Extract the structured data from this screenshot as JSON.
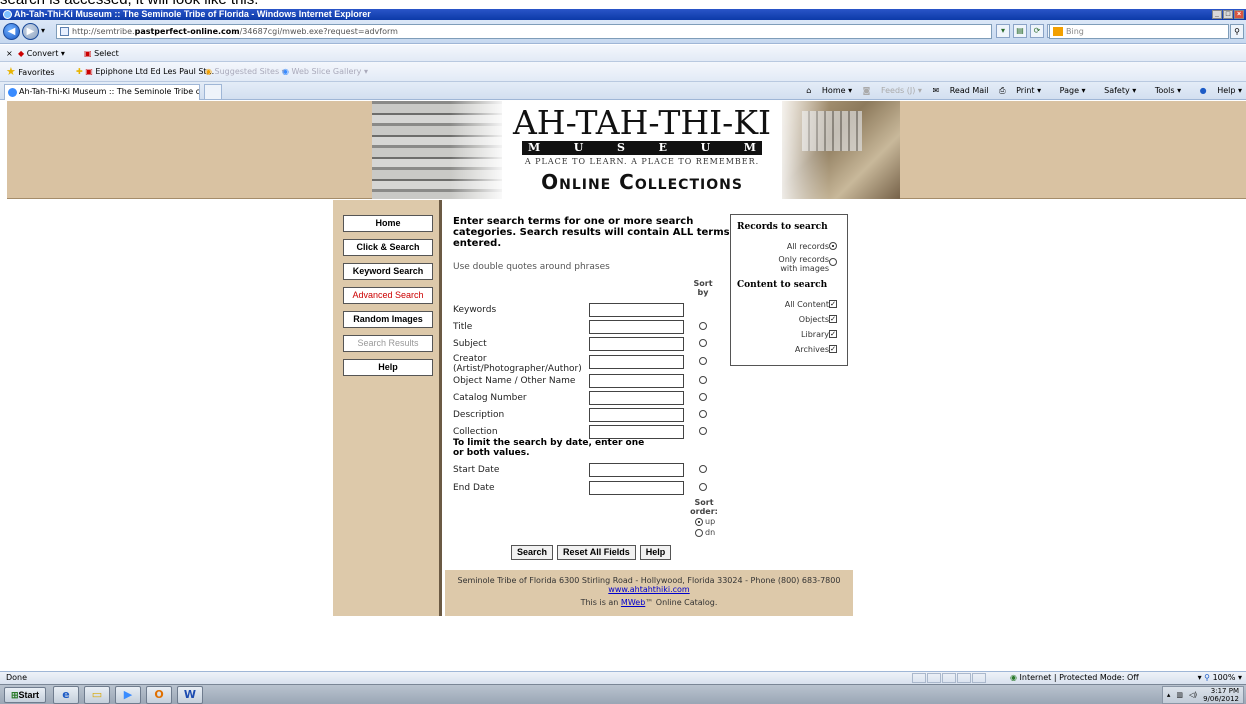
{
  "caption": "search is accessed, it will look like this:",
  "window": {
    "title": "Ah-Tah-Thi-Ki Museum :: The Seminole Tribe of Florida - Windows Internet Explorer"
  },
  "browser": {
    "url_prefix": "http://semtribe.",
    "url_domain": "pastperfect-online.com",
    "url_path": "/34687cgi/mweb.exe?request=advform",
    "search_placeholder": "Bing",
    "convert_label": "Convert",
    "select_label": "Select",
    "favorites_label": "Favorites",
    "fav_item_1": "Epiphone Ltd Ed Les Paul St...",
    "fav_item_2": "Suggested Sites",
    "fav_item_3": "Web Slice Gallery",
    "tab_label": "Ah-Tah-Thi-Ki Museum :: The Seminole Tribe of Florida",
    "cmd_home": "Home",
    "cmd_feeds": "Feeds (J)",
    "cmd_readmail": "Read Mail",
    "cmd_print": "Print",
    "cmd_page": "Page",
    "cmd_safety": "Safety",
    "cmd_tools": "Tools",
    "cmd_help": "Help"
  },
  "banner": {
    "title": "AH-TAH-THI-KI",
    "museum_letters": [
      "M",
      "U",
      "S",
      "E",
      "U",
      "M"
    ],
    "tagline": "A PLACE TO LEARN. A PLACE TO REMEMBER.",
    "subtitle": "Online Collections"
  },
  "nav": {
    "home": "Home",
    "click_search": "Click & Search",
    "keyword_search": "Keyword Search",
    "advanced_search": "Advanced Search",
    "random_images": "Random Images",
    "search_results": "Search Results",
    "help": "Help"
  },
  "form": {
    "instructions": "Enter search terms for one or more search categories. Search results will contain ALL terms entered.",
    "hint": "Use double quotes around phrases",
    "sort_by": "Sort by",
    "fields": {
      "keywords": "Keywords",
      "title": "Title",
      "subject": "Subject",
      "creator": "Creator (Artist/Photographer/Author)",
      "object_name": "Object Name / Other Name",
      "catalog_number": "Catalog Number",
      "description": "Description",
      "collection": "Collection",
      "start_date": "Start Date",
      "end_date": "End Date"
    },
    "date_hint": "To limit the search by date, enter one or both values.",
    "sort_order": "Sort order:",
    "sort_up": "up",
    "sort_dn": "dn",
    "search_btn": "Search",
    "reset_btn": "Reset All Fields",
    "help_btn": "Help"
  },
  "records": {
    "heading": "Records to search",
    "all_records": "All records",
    "only_images": "Only records with images",
    "content_heading": "Content to search",
    "all_content": "All Content",
    "objects": "Objects",
    "library": "Library",
    "archives": "Archives"
  },
  "footer": {
    "address": "Seminole Tribe of Florida 6300 Stirling Road - Hollywood, Florida 33024 - Phone (800) 683-7800",
    "website": "www.ahtahthiki.com",
    "mweb_prefix": "This is an",
    "mweb_link": "MWeb",
    "mweb_suffix": "™ Online Catalog."
  },
  "status": {
    "left": "Done",
    "zone": "Internet | Protected Mode: Off",
    "zoom": "100%"
  },
  "taskbar": {
    "start": "Start",
    "time": "3:17 PM",
    "date": "9/06/2012"
  }
}
